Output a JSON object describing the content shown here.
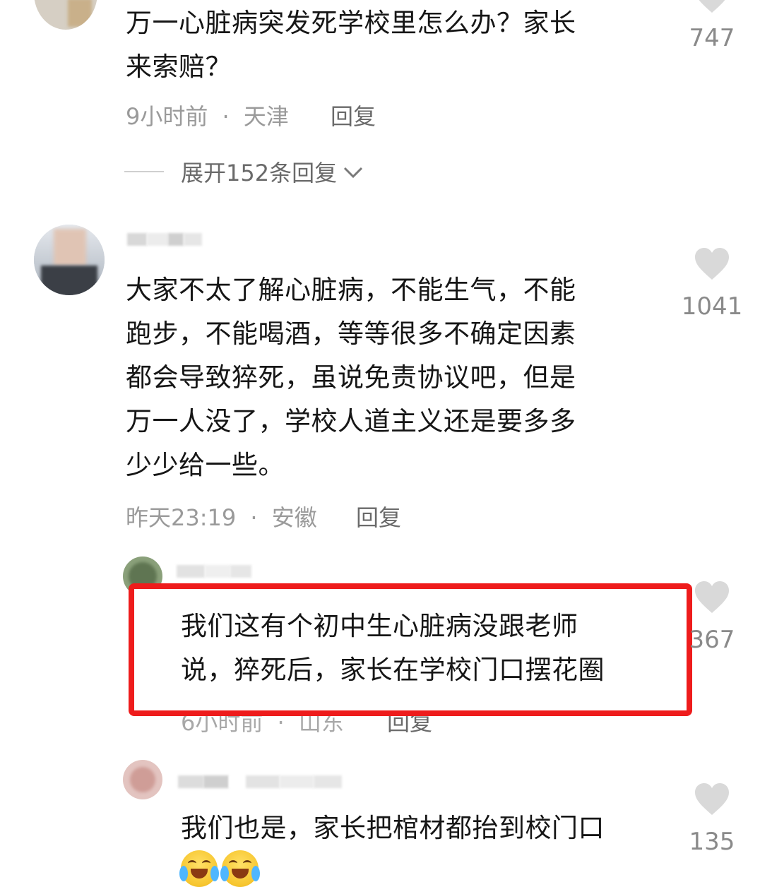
{
  "comments": [
    {
      "text_lines": [
        "万一心脏病突发死学校里怎么办？家长",
        "来索赔？"
      ],
      "time": "9小时前",
      "location": "天津",
      "reply_label": "回复",
      "likes": "747",
      "expand_label": "展开152条回复"
    },
    {
      "text_lines": [
        "大家不太了解心脏病，不能生气，不能",
        "跑步，不能喝酒，等等很多不确定因素",
        "都会导致猝死，虽说免责协议吧，但是",
        "万一人没了，学校人道主义还是要多多",
        "少少给一些。"
      ],
      "time": "昨天23:19",
      "location": "安徽",
      "reply_label": "回复",
      "likes": "1041"
    },
    {
      "text_lines": [
        "我们这有个初中生心脏病没跟老师",
        "说，猝死后，家长在学校门口摆花圈"
      ],
      "time": "6小时前",
      "location": "山东",
      "reply_label": "回复",
      "likes": "367"
    },
    {
      "text_lines": [
        "我们也是，家长把棺材都抬到校门口"
      ],
      "likes": "135"
    }
  ],
  "separator": "·",
  "colors": {
    "highlight_border": "#ee1c1c",
    "meta_text": "#9a9a9a",
    "heart": "#d9d9d9"
  }
}
